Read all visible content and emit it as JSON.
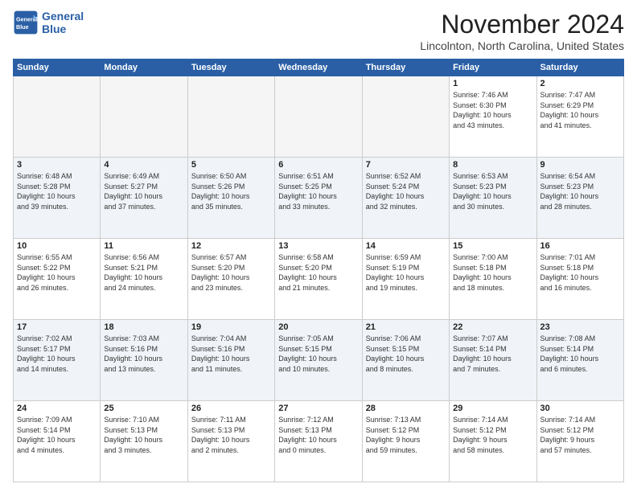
{
  "logo": {
    "line1": "General",
    "line2": "Blue"
  },
  "title": "November 2024",
  "location": "Lincolnton, North Carolina, United States",
  "days_header": [
    "Sunday",
    "Monday",
    "Tuesday",
    "Wednesday",
    "Thursday",
    "Friday",
    "Saturday"
  ],
  "weeks": [
    {
      "alt": false,
      "days": [
        {
          "num": "",
          "empty": true,
          "info": ""
        },
        {
          "num": "",
          "empty": true,
          "info": ""
        },
        {
          "num": "",
          "empty": true,
          "info": ""
        },
        {
          "num": "",
          "empty": true,
          "info": ""
        },
        {
          "num": "",
          "empty": true,
          "info": ""
        },
        {
          "num": "1",
          "empty": false,
          "info": "Sunrise: 7:46 AM\nSunset: 6:30 PM\nDaylight: 10 hours\nand 43 minutes."
        },
        {
          "num": "2",
          "empty": false,
          "info": "Sunrise: 7:47 AM\nSunset: 6:29 PM\nDaylight: 10 hours\nand 41 minutes."
        }
      ]
    },
    {
      "alt": true,
      "days": [
        {
          "num": "3",
          "empty": false,
          "info": "Sunrise: 6:48 AM\nSunset: 5:28 PM\nDaylight: 10 hours\nand 39 minutes."
        },
        {
          "num": "4",
          "empty": false,
          "info": "Sunrise: 6:49 AM\nSunset: 5:27 PM\nDaylight: 10 hours\nand 37 minutes."
        },
        {
          "num": "5",
          "empty": false,
          "info": "Sunrise: 6:50 AM\nSunset: 5:26 PM\nDaylight: 10 hours\nand 35 minutes."
        },
        {
          "num": "6",
          "empty": false,
          "info": "Sunrise: 6:51 AM\nSunset: 5:25 PM\nDaylight: 10 hours\nand 33 minutes."
        },
        {
          "num": "7",
          "empty": false,
          "info": "Sunrise: 6:52 AM\nSunset: 5:24 PM\nDaylight: 10 hours\nand 32 minutes."
        },
        {
          "num": "8",
          "empty": false,
          "info": "Sunrise: 6:53 AM\nSunset: 5:23 PM\nDaylight: 10 hours\nand 30 minutes."
        },
        {
          "num": "9",
          "empty": false,
          "info": "Sunrise: 6:54 AM\nSunset: 5:23 PM\nDaylight: 10 hours\nand 28 minutes."
        }
      ]
    },
    {
      "alt": false,
      "days": [
        {
          "num": "10",
          "empty": false,
          "info": "Sunrise: 6:55 AM\nSunset: 5:22 PM\nDaylight: 10 hours\nand 26 minutes."
        },
        {
          "num": "11",
          "empty": false,
          "info": "Sunrise: 6:56 AM\nSunset: 5:21 PM\nDaylight: 10 hours\nand 24 minutes."
        },
        {
          "num": "12",
          "empty": false,
          "info": "Sunrise: 6:57 AM\nSunset: 5:20 PM\nDaylight: 10 hours\nand 23 minutes."
        },
        {
          "num": "13",
          "empty": false,
          "info": "Sunrise: 6:58 AM\nSunset: 5:20 PM\nDaylight: 10 hours\nand 21 minutes."
        },
        {
          "num": "14",
          "empty": false,
          "info": "Sunrise: 6:59 AM\nSunset: 5:19 PM\nDaylight: 10 hours\nand 19 minutes."
        },
        {
          "num": "15",
          "empty": false,
          "info": "Sunrise: 7:00 AM\nSunset: 5:18 PM\nDaylight: 10 hours\nand 18 minutes."
        },
        {
          "num": "16",
          "empty": false,
          "info": "Sunrise: 7:01 AM\nSunset: 5:18 PM\nDaylight: 10 hours\nand 16 minutes."
        }
      ]
    },
    {
      "alt": true,
      "days": [
        {
          "num": "17",
          "empty": false,
          "info": "Sunrise: 7:02 AM\nSunset: 5:17 PM\nDaylight: 10 hours\nand 14 minutes."
        },
        {
          "num": "18",
          "empty": false,
          "info": "Sunrise: 7:03 AM\nSunset: 5:16 PM\nDaylight: 10 hours\nand 13 minutes."
        },
        {
          "num": "19",
          "empty": false,
          "info": "Sunrise: 7:04 AM\nSunset: 5:16 PM\nDaylight: 10 hours\nand 11 minutes."
        },
        {
          "num": "20",
          "empty": false,
          "info": "Sunrise: 7:05 AM\nSunset: 5:15 PM\nDaylight: 10 hours\nand 10 minutes."
        },
        {
          "num": "21",
          "empty": false,
          "info": "Sunrise: 7:06 AM\nSunset: 5:15 PM\nDaylight: 10 hours\nand 8 minutes."
        },
        {
          "num": "22",
          "empty": false,
          "info": "Sunrise: 7:07 AM\nSunset: 5:14 PM\nDaylight: 10 hours\nand 7 minutes."
        },
        {
          "num": "23",
          "empty": false,
          "info": "Sunrise: 7:08 AM\nSunset: 5:14 PM\nDaylight: 10 hours\nand 6 minutes."
        }
      ]
    },
    {
      "alt": false,
      "days": [
        {
          "num": "24",
          "empty": false,
          "info": "Sunrise: 7:09 AM\nSunset: 5:14 PM\nDaylight: 10 hours\nand 4 minutes."
        },
        {
          "num": "25",
          "empty": false,
          "info": "Sunrise: 7:10 AM\nSunset: 5:13 PM\nDaylight: 10 hours\nand 3 minutes."
        },
        {
          "num": "26",
          "empty": false,
          "info": "Sunrise: 7:11 AM\nSunset: 5:13 PM\nDaylight: 10 hours\nand 2 minutes."
        },
        {
          "num": "27",
          "empty": false,
          "info": "Sunrise: 7:12 AM\nSunset: 5:13 PM\nDaylight: 10 hours\nand 0 minutes."
        },
        {
          "num": "28",
          "empty": false,
          "info": "Sunrise: 7:13 AM\nSunset: 5:12 PM\nDaylight: 9 hours\nand 59 minutes."
        },
        {
          "num": "29",
          "empty": false,
          "info": "Sunrise: 7:14 AM\nSunset: 5:12 PM\nDaylight: 9 hours\nand 58 minutes."
        },
        {
          "num": "30",
          "empty": false,
          "info": "Sunrise: 7:14 AM\nSunset: 5:12 PM\nDaylight: 9 hours\nand 57 minutes."
        }
      ]
    }
  ]
}
